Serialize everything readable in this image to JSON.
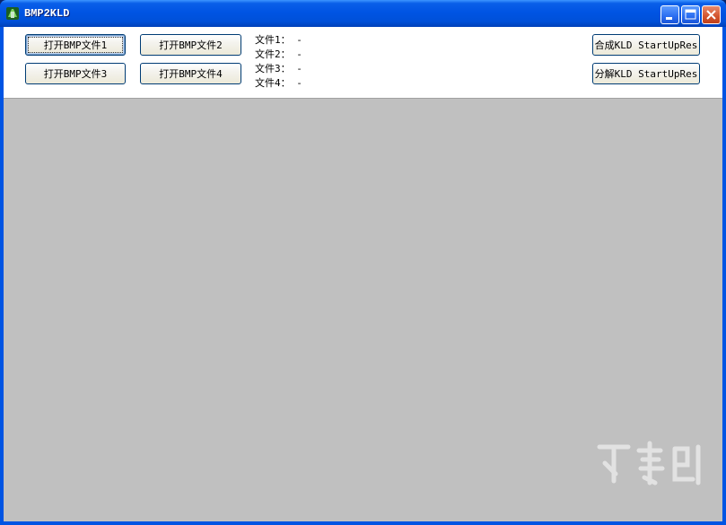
{
  "window": {
    "title": "BMP2KLD",
    "controls": [
      "minimize-icon",
      "maximize-icon",
      "close-icon"
    ]
  },
  "buttons": {
    "open1": "打开BMP文件1",
    "open2": "打开BMP文件2",
    "open3": "打开BMP文件3",
    "open4": "打开BMP文件4",
    "compose": "合成KLD StartUpRes",
    "decompose": "分解KLD StartUpRes"
  },
  "files": [
    {
      "label": "文件1：",
      "value": "-"
    },
    {
      "label": "文件2：",
      "value": "-"
    },
    {
      "label": "文件3：",
      "value": "-"
    },
    {
      "label": "文件4：",
      "value": "-"
    }
  ],
  "colors": {
    "titlebar": "#0054e3",
    "client_background": "#c0c0c0",
    "panel": "#ffffff",
    "button_face": "#ece9d8"
  }
}
